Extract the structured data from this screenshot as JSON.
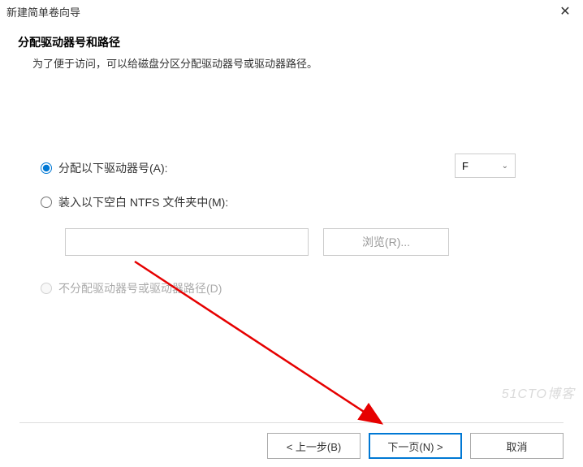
{
  "titlebar": {
    "title": "新建简单卷向导"
  },
  "header": {
    "title": "分配驱动器号和路径",
    "description": "为了便于访问，可以给磁盘分区分配驱动器号或驱动器路径。"
  },
  "options": {
    "assign_letter": {
      "label": "分配以下驱动器号(A):",
      "selected": true,
      "drive": "F"
    },
    "mount_folder": {
      "label": "装入以下空白 NTFS 文件夹中(M):",
      "selected": false,
      "path": "",
      "browse_label": "浏览(R)..."
    },
    "no_assign": {
      "label": "不分配驱动器号或驱动器路径(D)",
      "selected": false,
      "disabled": true
    }
  },
  "footer": {
    "back": "< 上一步(B)",
    "next": "下一页(N) >",
    "cancel": "取消"
  },
  "watermark": "51CTO博客"
}
